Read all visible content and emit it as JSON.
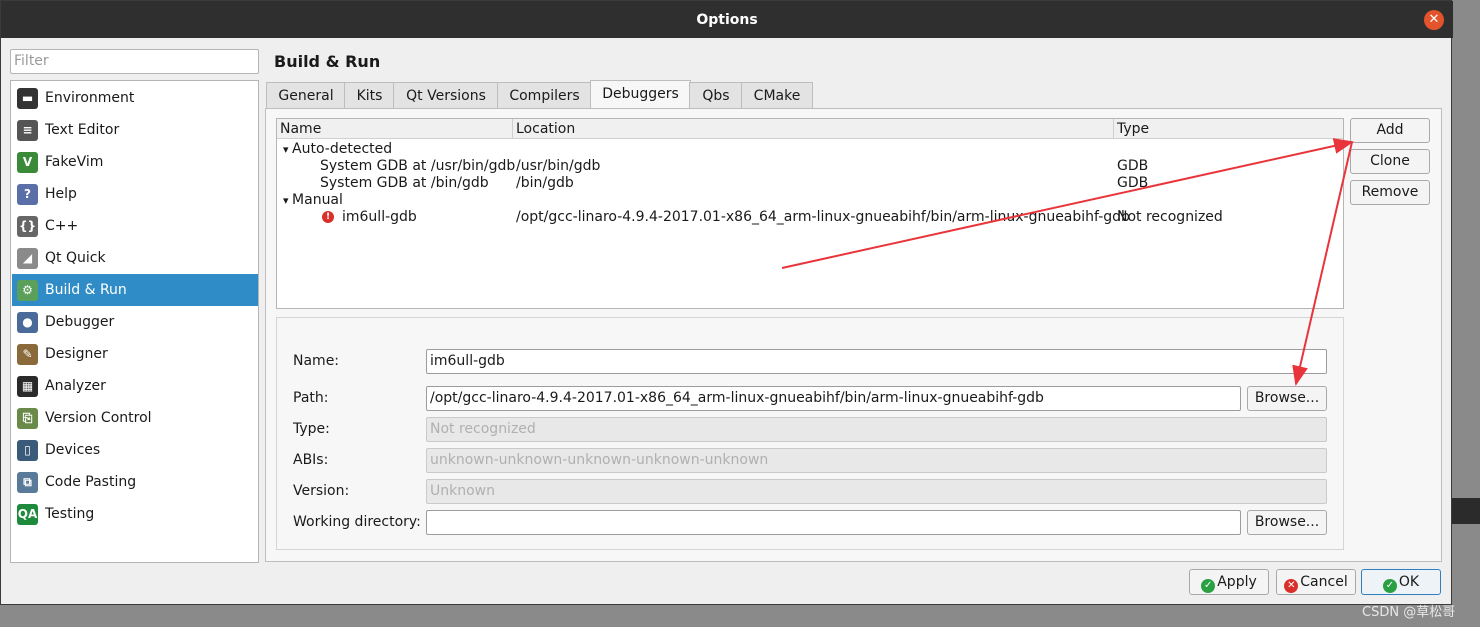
{
  "window": {
    "title": "Options",
    "close_glyph": "✕"
  },
  "sidebar": {
    "filter_placeholder": "Filter",
    "items": [
      {
        "label": "Environment",
        "icon": "environment-icon",
        "glyph": "▬",
        "color": "#333333"
      },
      {
        "label": "Text Editor",
        "icon": "text-editor-icon",
        "glyph": "≡",
        "color": "#555555"
      },
      {
        "label": "FakeVim",
        "icon": "fakevim-icon",
        "glyph": "V",
        "color": "#3a8a3a"
      },
      {
        "label": "Help",
        "icon": "help-icon",
        "glyph": "?",
        "color": "#5a6fa8"
      },
      {
        "label": "C++",
        "icon": "cpp-icon",
        "glyph": "{}",
        "color": "#666666"
      },
      {
        "label": "Qt Quick",
        "icon": "qt-quick-icon",
        "glyph": "◢",
        "color": "#8a8a8a"
      },
      {
        "label": "Build & Run",
        "icon": "build-run-icon",
        "glyph": "⚙",
        "color": "#5aa05a",
        "selected": true
      },
      {
        "label": "Debugger",
        "icon": "debugger-icon",
        "glyph": "●",
        "color": "#4a6a9a"
      },
      {
        "label": "Designer",
        "icon": "designer-icon",
        "glyph": "✎",
        "color": "#8a6a3a"
      },
      {
        "label": "Analyzer",
        "icon": "analyzer-icon",
        "glyph": "▦",
        "color": "#2a2a2a"
      },
      {
        "label": "Version Control",
        "icon": "version-control-icon",
        "glyph": "⎘",
        "color": "#6a8a4a"
      },
      {
        "label": "Devices",
        "icon": "devices-icon",
        "glyph": "▯",
        "color": "#3a5a7a"
      },
      {
        "label": "Code Pasting",
        "icon": "code-pasting-icon",
        "glyph": "⧉",
        "color": "#5a7a9a"
      },
      {
        "label": "Testing",
        "icon": "testing-icon",
        "glyph": "QA",
        "color": "#1e8a3c"
      }
    ]
  },
  "page": {
    "title": "Build & Run"
  },
  "tabs": [
    {
      "label": "General"
    },
    {
      "label": "Kits"
    },
    {
      "label": "Qt Versions"
    },
    {
      "label": "Compilers"
    },
    {
      "label": "Debuggers",
      "selected": true
    },
    {
      "label": "Qbs"
    },
    {
      "label": "CMake"
    }
  ],
  "debuggers": {
    "columns": [
      "Name",
      "Location",
      "Type"
    ],
    "groups": [
      {
        "label": "Auto-detected",
        "rows": [
          {
            "name": "System GDB at /usr/bin/gdb",
            "location": "/usr/bin/gdb",
            "type": "GDB"
          },
          {
            "name": "System GDB at /bin/gdb",
            "location": "/bin/gdb",
            "type": "GDB"
          }
        ]
      },
      {
        "label": "Manual",
        "rows": [
          {
            "name": "im6ull-gdb",
            "location": "/opt/gcc-linaro-4.9.4-2017.01-x86_64_arm-linux-gnueabihf/bin/arm-linux-gnueabihf-gdb",
            "type": "Not recognized",
            "error_icon": "error-icon"
          }
        ]
      }
    ],
    "buttons": {
      "add": "Add",
      "clone": "Clone",
      "remove": "Remove"
    }
  },
  "details": {
    "name_label": "Name:",
    "name_value": "im6ull-gdb",
    "path_label": "Path:",
    "path_value": "/opt/gcc-linaro-4.9.4-2017.01-x86_64_arm-linux-gnueabihf/bin/arm-linux-gnueabihf-gdb",
    "type_label": "Type:",
    "type_value": "Not recognized",
    "abis_label": "ABIs:",
    "abis_value": "unknown-unknown-unknown-unknown-unknown",
    "version_label": "Version:",
    "version_value": "Unknown",
    "workdir_label": "Working directory:",
    "workdir_value": "",
    "browse_label": "Browse..."
  },
  "dialog_buttons": {
    "apply": "Apply",
    "cancel": "Cancel",
    "ok": "OK"
  },
  "colors": {
    "selection": "#308cc6",
    "annotation_arrow": "#e8343a",
    "error": "#d9302c",
    "ok_green": "#2aa043"
  },
  "watermark": "CSDN @草松哥"
}
